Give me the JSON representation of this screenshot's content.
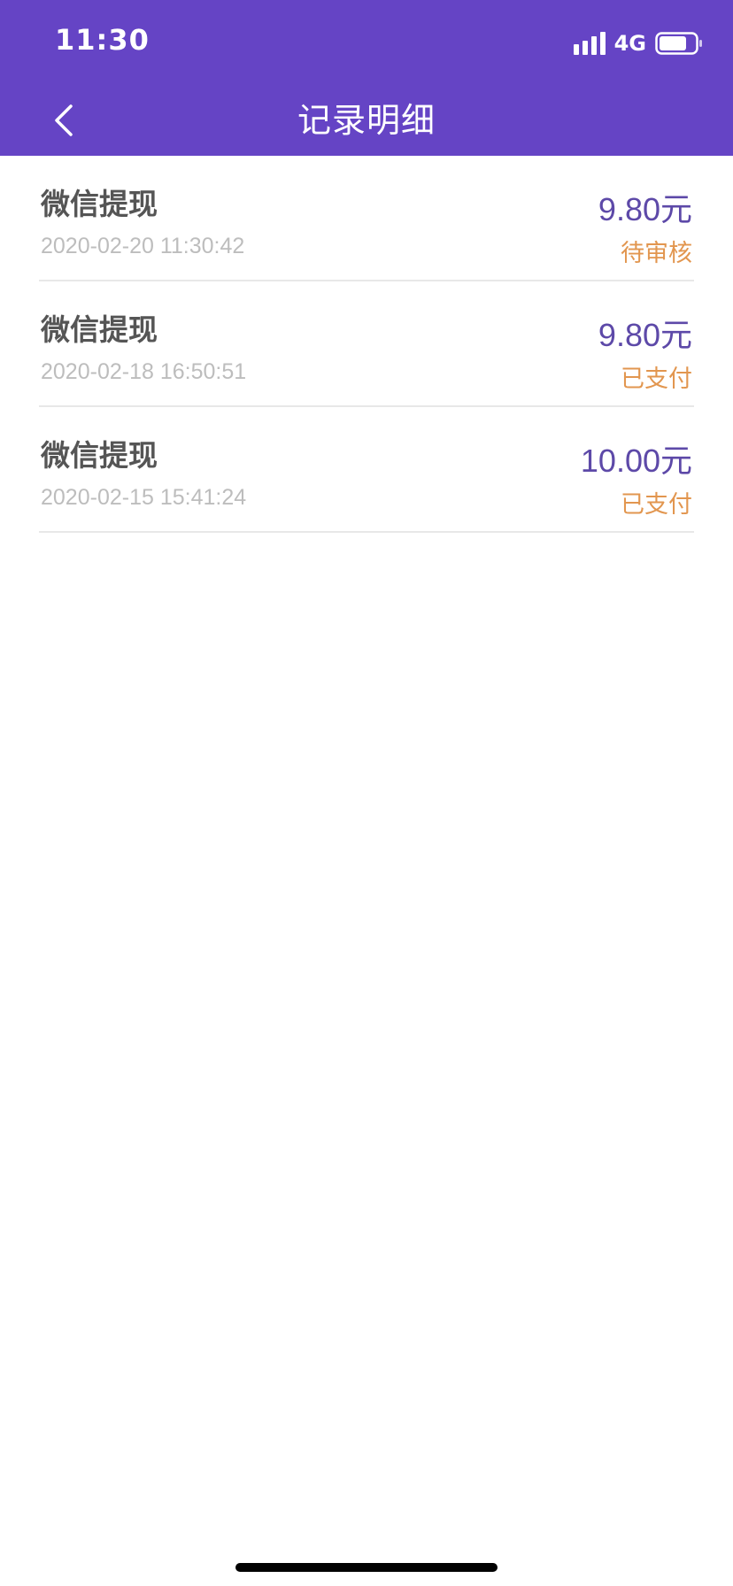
{
  "status_bar": {
    "time": "11:30",
    "network": "4G",
    "signal_icon": "signal-bars-icon",
    "battery_icon": "battery-icon"
  },
  "header": {
    "title": "记录明细",
    "back_icon": "chevron-left-icon"
  },
  "colors": {
    "header_bg": "#6544C5",
    "amount": "#5D49A8",
    "status": "#E2964F",
    "title_text": "#555555",
    "time_text": "#BDBDBD",
    "divider": "#E8E8E8"
  },
  "records": [
    {
      "title": "微信提现",
      "time": "2020-02-20 11:30:42",
      "amount": "9.80元",
      "status": "待审核"
    },
    {
      "title": "微信提现",
      "time": "2020-02-18 16:50:51",
      "amount": "9.80元",
      "status": "已支付"
    },
    {
      "title": "微信提现",
      "time": "2020-02-15 15:41:24",
      "amount": "10.00元",
      "status": "已支付"
    }
  ]
}
